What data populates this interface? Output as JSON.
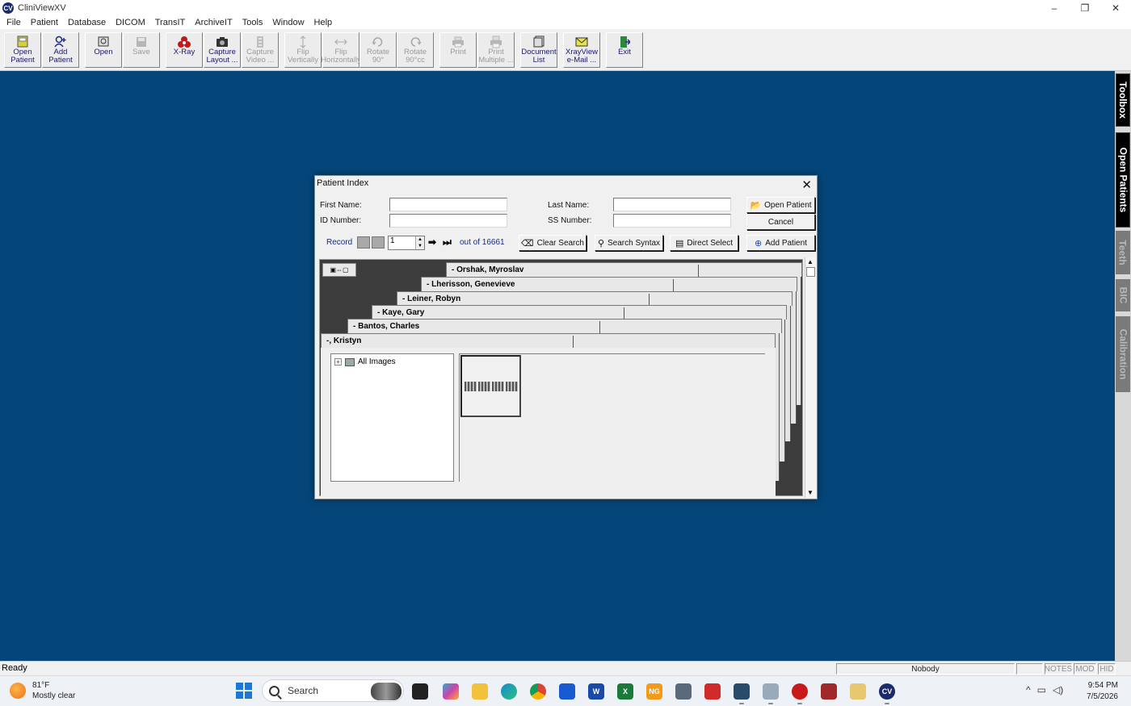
{
  "app": {
    "title": "CliniViewXV",
    "icon_label": "CV",
    "window_controls": [
      "–",
      "❐",
      "✕"
    ]
  },
  "menu": [
    "File",
    "Patient",
    "Database",
    "DICOM",
    "TransIT",
    "ArchiveIT",
    "Tools",
    "Window",
    "Help"
  ],
  "toolbar": [
    {
      "label": "Open\nPatient",
      "icon": "open-patient-icon",
      "enabled": true
    },
    {
      "label": "Add\nPatient",
      "icon": "add-patient-icon",
      "enabled": true
    },
    {
      "label": "Open",
      "icon": "open-icon",
      "enabled": true
    },
    {
      "label": "Save",
      "icon": "save-icon",
      "enabled": false
    },
    {
      "label": "X-Ray",
      "icon": "xray-icon",
      "enabled": true
    },
    {
      "label": "Capture\nLayout ...",
      "icon": "capture-layout-icon",
      "enabled": true
    },
    {
      "label": "Capture\nVideo ...",
      "icon": "capture-video-icon",
      "enabled": false
    },
    {
      "label": "Flip\nVertically",
      "icon": "flip-vertical-icon",
      "enabled": false
    },
    {
      "label": "Flip\nHorizontally",
      "icon": "flip-horizontal-icon",
      "enabled": false
    },
    {
      "label": "Rotate\n90°",
      "icon": "rotate-cw-icon",
      "enabled": false
    },
    {
      "label": "Rotate\n90°cc",
      "icon": "rotate-ccw-icon",
      "enabled": false
    },
    {
      "label": "Print",
      "icon": "print-icon",
      "enabled": false
    },
    {
      "label": "Print\nMultiple ...",
      "icon": "print-multiple-icon",
      "enabled": false
    },
    {
      "label": "Document\nList",
      "icon": "document-list-icon",
      "enabled": true
    },
    {
      "label": "XrayView\ne-Mail ...",
      "icon": "email-icon",
      "enabled": true
    },
    {
      "label": "Exit",
      "icon": "exit-icon",
      "enabled": true
    }
  ],
  "side_tabs": [
    {
      "label": "Toolbox",
      "active": true
    },
    {
      "label": "Open Patients",
      "active": true
    },
    {
      "label": "Teeth",
      "active": false
    },
    {
      "label": "BIC",
      "active": false
    },
    {
      "label": "Calibration",
      "active": false
    }
  ],
  "dialog": {
    "title": "Patient Index",
    "close": "✕",
    "first_name_label": "First Name:",
    "first_name_value": "",
    "last_name_label": "Last Name:",
    "last_name_value": "",
    "id_number_label": "ID Number:",
    "id_number_value": "",
    "ss_number_label": "SS Number:",
    "ss_number_value": "",
    "open_patient_btn": "Open Patient",
    "cancel_btn": "Cancel",
    "record_label": "Record",
    "record_value": "1",
    "record_total": "out of 16661",
    "clear_search_btn": "Clear Search",
    "search_syntax_btn": "Search Syntax",
    "direct_select_btn": "Direct Select",
    "add_patient_btn": "Add Patient",
    "patient_tabs": [
      "- Orshak, Myroslav",
      "- Lherisson, Genevieve",
      "- Leiner, Robyn",
      "- Kaye, Gary",
      "- Bantos, Charles",
      "-, Kristyn"
    ],
    "tree_root": "All Images",
    "tree_expander": "+"
  },
  "status": {
    "ready": "Ready",
    "user": "Nobody",
    "flags": [
      "NOTES",
      "MOD",
      "HID"
    ]
  },
  "taskbar": {
    "weather_temp": "81°F",
    "weather_desc": "Mostly clear",
    "search_placeholder": "Search",
    "time": "9:54 PM",
    "date": "7/5/2026",
    "tray_symbols": [
      "^",
      "▭",
      "◁)"
    ]
  }
}
